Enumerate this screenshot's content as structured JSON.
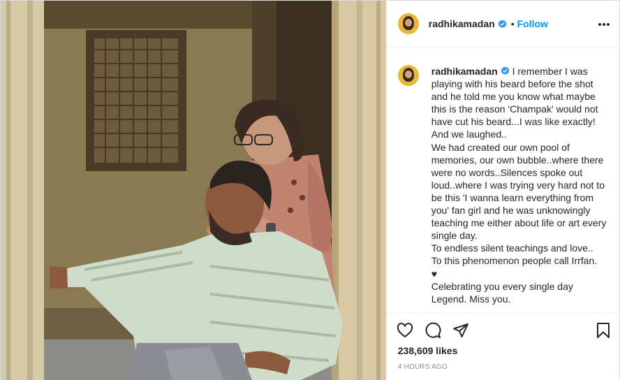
{
  "post": {
    "username": "radhikamadan",
    "follow_label": "Follow",
    "dot": "•",
    "caption_username": "radhikamadan",
    "caption": "I remember I was playing with his beard before the shot and he told me you know what maybe this is the reason 'Champak' would not have cut his beard...I was like exactly! And we laughed..\nWe had created our own pool of memories, our own bubble..where there were no words..Silences spoke out loud..where I was trying very hard not to be this 'I wanna learn everything from you' fan girl and he was unknowingly teaching me either about life or art every single day.\nTo endless silent teachings and love..\nTo this phenomenon people call Irrfan.\n♥\nCelebrating you every single day\nLegend. Miss you.",
    "likes": "238,609 likes",
    "time": "4 HOURS AGO"
  },
  "icons": {
    "verified": "verified-badge-icon",
    "more": "more-options-icon",
    "like": "heart-icon",
    "comment": "comment-icon",
    "share": "paper-plane-icon",
    "save": "bookmark-icon"
  },
  "colors": {
    "accent": "#0095f6",
    "text": "#262626",
    "muted": "#8e8e8e",
    "border": "#efefef"
  }
}
